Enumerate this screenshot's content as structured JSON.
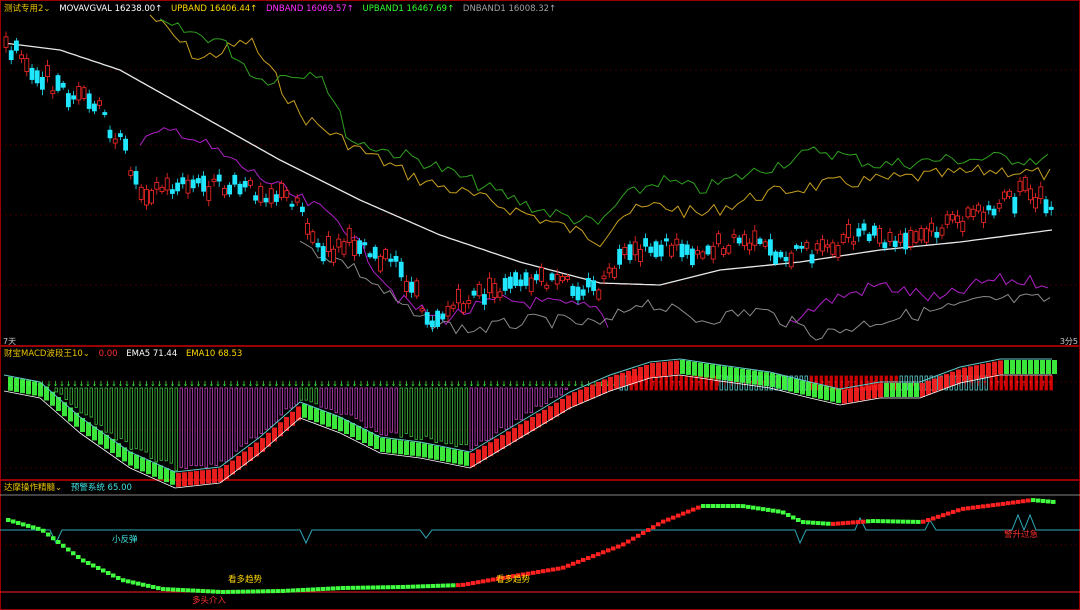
{
  "colors": {
    "up": "#ff2a2a",
    "down": "#20e6ff",
    "ma": "#e8e8e8",
    "upband": "#c8a020",
    "dnband": "#b020c8",
    "upband1": "#30a020",
    "dnband1": "#8a8a8a",
    "grid": "#7a0000",
    "panel_border": "#9a0000",
    "macd_green": "#40ff40",
    "macd_red": "#ff2020",
    "ema_teal": "#60c8c8",
    "hist_green": "#40c040",
    "hist_magenta": "#c040c0",
    "deep_red": "#cc0000"
  },
  "main_panel": {
    "legend": [
      {
        "label": "测试专用2",
        "color": "#e8c200",
        "icon": "chevron-down-icon"
      },
      {
        "label": "MOVAVGVAL 16238.00↑",
        "color": "#ffffff"
      },
      {
        "label": "UPBAND 16406.44↑",
        "color": "#ffd800"
      },
      {
        "label": "DNBAND 16069.57↑",
        "color": "#ff30ff"
      },
      {
        "label": "UPBAND1 16467.69↑",
        "color": "#30ff30"
      },
      {
        "label": "DNBAND1 16008.32↑",
        "color": "#a0a0a0"
      }
    ],
    "corner_left": "7天",
    "corner_right": "3分5"
  },
  "macd_panel": {
    "legend": [
      {
        "label": "财宝MACD波段王10",
        "color": "#e8c200",
        "icon": "chevron-down-icon"
      },
      {
        "label": "0.00",
        "color": "#ff3030"
      },
      {
        "label": "EMA5 71.44",
        "color": "#ffffff"
      },
      {
        "label": "EMA10 68.53",
        "color": "#ffd800"
      }
    ]
  },
  "osc_panel": {
    "legend": [
      {
        "label": "达摩操作精髓",
        "color": "#e8c200",
        "icon": "chevron-down-icon"
      },
      {
        "label": "预警系统 65.00",
        "color": "#40e0e0"
      }
    ],
    "annotations": [
      {
        "text": "小反弹",
        "color": "#40e0e0"
      },
      {
        "text": "看多趋势",
        "color": "#ffd800"
      },
      {
        "text": "看多趋势",
        "color": "#ffd800"
      },
      {
        "text": "多头介入",
        "color": "#ff3030"
      },
      {
        "text": "警升过急",
        "color": "#ff3030"
      }
    ]
  },
  "chart_data": [
    {
      "type": "candlestick",
      "series": [
        {
          "name": "MOVAVGVAL",
          "values": [
            16238.0
          ]
        },
        {
          "name": "UPBAND",
          "values": [
            16406.44
          ]
        },
        {
          "name": "DNBAND",
          "values": [
            16069.57
          ]
        },
        {
          "name": "UPBAND1",
          "values": [
            16467.69
          ]
        },
        {
          "name": "DNBAND1",
          "values": [
            16008.32
          ]
        }
      ]
    },
    {
      "type": "bar",
      "series": [
        {
          "name": "EMA5",
          "values": [
            71.44
          ]
        },
        {
          "name": "EMA10",
          "values": [
            68.53
          ]
        }
      ]
    },
    {
      "type": "line",
      "series": [
        {
          "name": "预警系统",
          "values": [
            65.0
          ]
        }
      ]
    }
  ]
}
